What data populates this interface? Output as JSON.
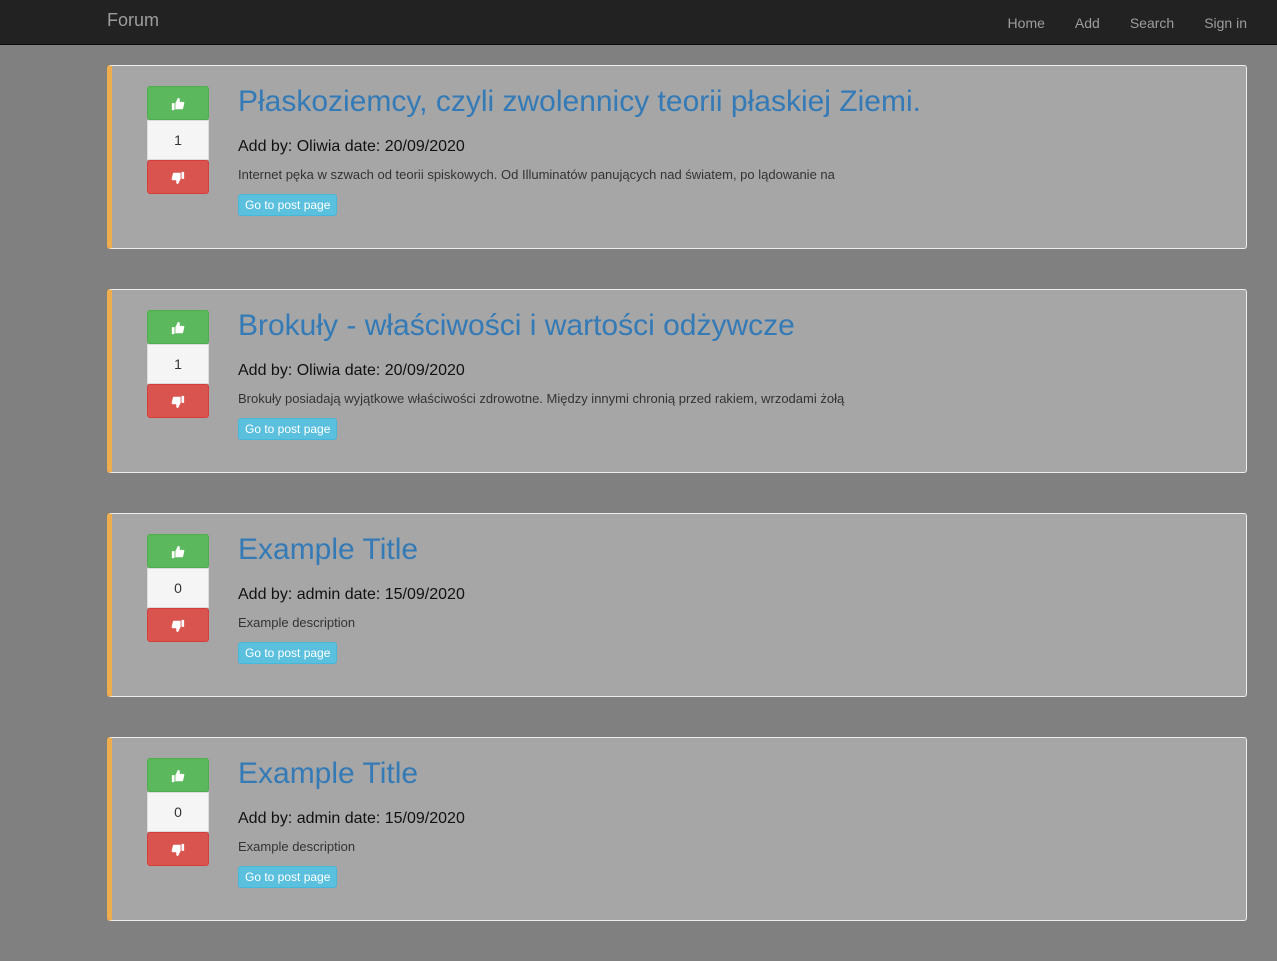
{
  "navbar": {
    "brand": "Forum",
    "links": [
      "Home",
      "Add",
      "Search",
      "Sign in"
    ]
  },
  "posts": [
    {
      "title": "Płaskoziemcy, czyli zwolennicy teorii płaskiej Ziemi.",
      "meta": "Add by: Oliwia date: 20/09/2020",
      "description": "Internet pęka w szwach od teorii spiskowych. Od Illuminatów panujących nad światem, po lądowanie na",
      "votes": "1",
      "button": "Go to post page"
    },
    {
      "title": "Brokuły - właściwości i wartości odżywcze",
      "meta": "Add by: Oliwia date: 20/09/2020",
      "description": "Brokuły posiadają wyjątkowe właściwości zdrowotne. Między innymi chronią przed rakiem, wrzodami żołą",
      "votes": "1",
      "button": "Go to post page"
    },
    {
      "title": "Example Title",
      "meta": "Add by: admin date: 15/09/2020",
      "description": "Example description",
      "votes": "0",
      "button": "Go to post page"
    },
    {
      "title": "Example Title",
      "meta": "Add by: admin date: 15/09/2020",
      "description": "Example description",
      "votes": "0",
      "button": "Go to post page"
    }
  ],
  "icons": {
    "upvote": "thumbs-up-icon",
    "downvote": "thumbs-down-icon"
  },
  "colors": {
    "accent": "#f0ad4e",
    "upvote": "#5cb85c",
    "downvote": "#d9534f",
    "link": "#337ab7",
    "info_button": "#5bc0de"
  }
}
